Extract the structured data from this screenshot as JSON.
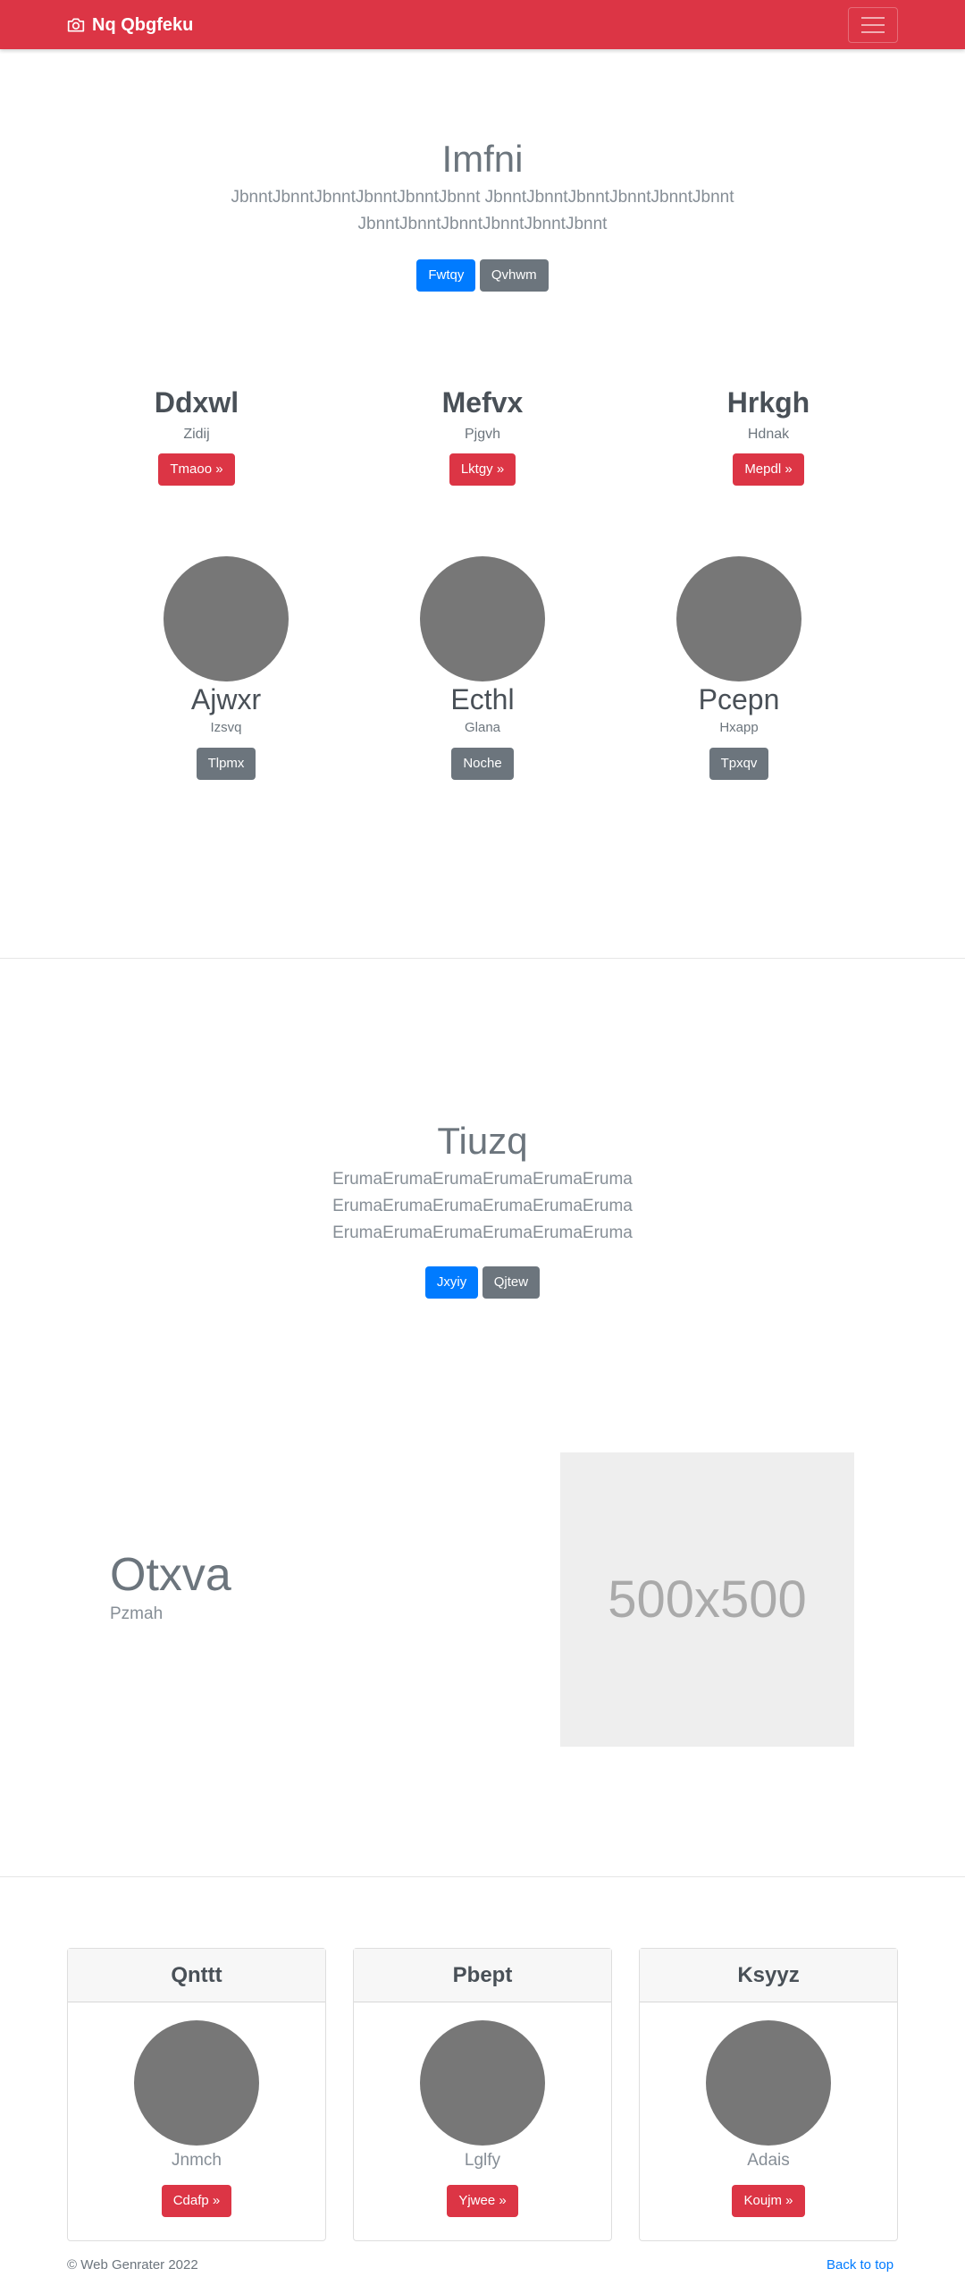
{
  "navbar": {
    "brand": "Nq Qbgfeku",
    "brand_icon": "camera-icon",
    "toggler_icon": "hamburger-icon"
  },
  "hero": {
    "title": "Imfni",
    "lead_line1": "JbnntJbnntJbnntJbnntJbnntJbnnt JbnntJbnntJbnntJbnntJbnntJbnnt",
    "lead_line2": "JbnntJbnntJbnntJbnntJbnntJbnnt",
    "button_primary": "Fwtqy",
    "button_secondary": "Qvhwm"
  },
  "features": [
    {
      "title": "Ddxwl",
      "sub": "Zidij",
      "button": "Tmaoo »"
    },
    {
      "title": "Mefvx",
      "sub": "Pjgvh",
      "button": "Lktgy »"
    },
    {
      "title": "Hrkgh",
      "sub": "Hdnak",
      "button": "Mepdl »"
    }
  ],
  "team": [
    {
      "name": "Ajwxr",
      "sub": "Izsvq",
      "button": "Tlpmx"
    },
    {
      "name": "Ecthl",
      "sub": "Glana",
      "button": "Noche"
    },
    {
      "name": "Pcepn",
      "sub": "Hxapp",
      "button": "Tpxqv"
    }
  ],
  "section2": {
    "title": "Tiuzq",
    "lead_lines": [
      "ErumaErumaErumaErumaErumaEruma",
      "ErumaErumaErumaErumaErumaEruma",
      "ErumaErumaErumaErumaErumaEruma"
    ],
    "button_primary": "Jxyiy",
    "button_secondary": "Qjtew"
  },
  "feature_row": {
    "title": "Otxva",
    "sub": "Pzmah",
    "image_label": "500x500"
  },
  "cards": [
    {
      "header": "Qnttt",
      "text": "Jnmch",
      "button": "Cdafp »"
    },
    {
      "header": "Pbept",
      "text": "Lglfy",
      "button": "Yjwee »"
    },
    {
      "header": "Ksyyz",
      "text": "Adais",
      "button": "Koujm »"
    }
  ],
  "footer": {
    "copyright": "© Web Genrater 2022",
    "back_to_top": "Back to top"
  },
  "colors": {
    "brand": "#dc3545",
    "primary": "#007bff",
    "secondary": "#6c757d",
    "placeholder": "#777777"
  }
}
